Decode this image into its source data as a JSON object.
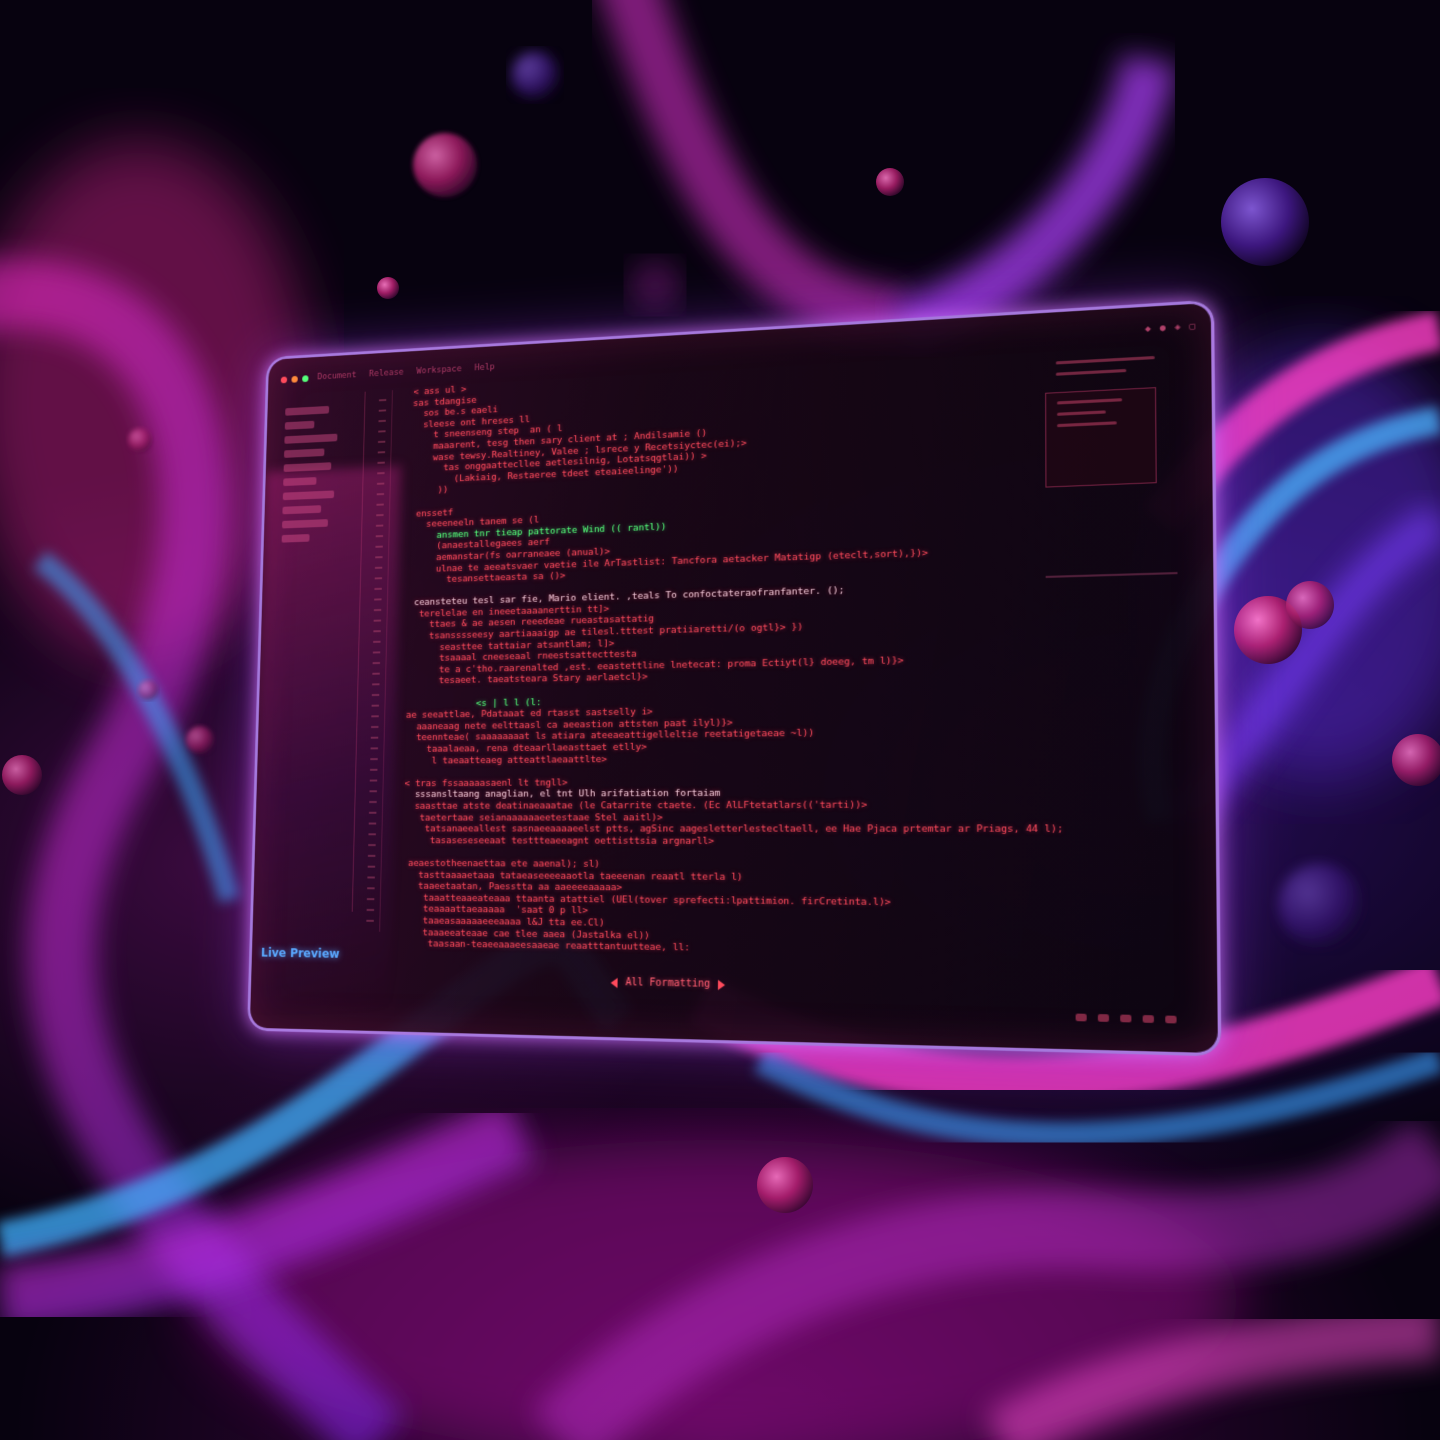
{
  "editor": {
    "menu": [
      "Document",
      "Release",
      "Workspace",
      "Help"
    ],
    "live_preview_label": "Live Preview",
    "status_label": "All Formatting"
  },
  "code_lines": [
    {
      "t": "  < ass ul >",
      "c": ""
    },
    {
      "t": "  sas tdangise",
      "c": ""
    },
    {
      "t": "    sos be.s eaeli",
      "c": ""
    },
    {
      "t": "    sleese ont hreses ll",
      "c": ""
    },
    {
      "t": "      t sneenseng step  an ( l",
      "c": ""
    },
    {
      "t": "      maaarent, tesg then sary client at ; Andilsamie ()",
      "c": ""
    },
    {
      "t": "      wase tewsy.Realtiney, Valee ; lsrece y Recetsiyctec(ei);>",
      "c": ""
    },
    {
      "t": "        tas onggaattecllee aetlesilnig, Lotatsqgtlai)) >",
      "c": ""
    },
    {
      "t": "          (Lakiaig, Restaeree tdeet eteaieelinge'))",
      "c": ""
    },
    {
      "t": "       ))",
      "c": ""
    },
    {
      "t": "",
      "c": ""
    },
    {
      "t": "   enssetf",
      "c": ""
    },
    {
      "t": "     seeeneeln tanem se (l",
      "c": ""
    },
    {
      "t": "       ansmen tnr tieap pattorate Wind (( rantl))",
      "c": "g"
    },
    {
      "t": "       (anaestallegaees aerf",
      "c": ""
    },
    {
      "t": "       aemanstar(fs oarraneaee (anual)>",
      "c": ""
    },
    {
      "t": "       ulnae te aeeatsvaer vaetie ile ArTastlist: Tancfora aetacker Matatigp (eteclt,sort),})>",
      "c": ""
    },
    {
      "t": "         tesansettaeasta sa ()>",
      "c": ""
    },
    {
      "t": "",
      "c": ""
    },
    {
      "t": "   ceansteteu tesl sar fie, Mario elient. ,teals To confoctateraofranfanter. ();",
      "c": "w"
    },
    {
      "t": "    terelelae en ineeetaaaanerttin tt]>",
      "c": ""
    },
    {
      "t": "      ttaes & ae aesen reeedeae rueastasattatig",
      "c": ""
    },
    {
      "t": "      tsansssseesy aartiaaaigp ae tilesl.tttest pratiiaretti/(o ogtl}> })",
      "c": ""
    },
    {
      "t": "        seasttee tattaiar atsantlam; l]>",
      "c": ""
    },
    {
      "t": "        tsaaaal cneeseaal rneestsattecttesta",
      "c": ""
    },
    {
      "t": "        te a c'tho.raarenalted ,est. eeastettline lnetecat: proma Ectiyt(l} doeeg, tm l)}>",
      "c": ""
    },
    {
      "t": "        tesaeet. taeatsteara Stary aerlaetcl}>",
      "c": ""
    },
    {
      "t": "",
      "c": ""
    },
    {
      "t": "               <s | l l (l:",
      "c": "g"
    },
    {
      "t": "  ae seeattlae, Pdataaat ed rtasst sastselly i>",
      "c": ""
    },
    {
      "t": "    aaaneaag nete eelttaasl ca aeeastion attsten paat ilyl)}>",
      "c": ""
    },
    {
      "t": "    teennteae( saaaaaaaat ls atiara ateeaeattigelleltie reetatigetaeae ~l))",
      "c": ""
    },
    {
      "t": "      taaalaeaa, rena dteaarllaeasttaet etlly>",
      "c": ""
    },
    {
      "t": "       l taeaatteaeg atteattlaeaattlte>",
      "c": ""
    },
    {
      "t": "",
      "c": ""
    },
    {
      "t": "  < tras fssaaaaasaenl lt tngll>",
      "c": ""
    },
    {
      "t": "    sssansltaang anaglian, el tnt Ulh arifatiation fortaiam",
      "c": "w"
    },
    {
      "t": "    saasttae atste deatinaeaaatae (le Catarrite ctaete. (Ec AlLFtetatlars(('tarti))>",
      "c": ""
    },
    {
      "t": "     taetertaae seianaaaaaaeetestaae Stel aaitl)>",
      "c": ""
    },
    {
      "t": "      tatsanaeeallest sasnaeeaaaaeelst ptts, agSinc aagesletterlestecltaell, ee Hae Pjaca prtemtar ar Priags, 44 l);",
      "c": ""
    },
    {
      "t": "       tasaseseseeaat testtteaeeagnt oettisttsia argnarll>",
      "c": ""
    },
    {
      "t": "",
      "c": ""
    },
    {
      "t": "   aeaestotheenaettaa ete aaenal); sl)",
      "c": ""
    },
    {
      "t": "     tasttaaaaetaaa tataeaseeeeaaotla taeeenan reaatl tterla l)",
      "c": ""
    },
    {
      "t": "     taaeetaatan, Paesstta aa aaeeeeaaaaa>",
      "c": ""
    },
    {
      "t": "      taaatteaaeateaaa ttaanta atattiel (UEl(tover sprefecti:lpattimion. firCretinta.l)>",
      "c": ""
    },
    {
      "t": "      teaaaattaeaaaaa  'saat 0 p ll>",
      "c": ""
    },
    {
      "t": "      taaeasaaaaaeeeaaaa l&J tta ee.Cl)",
      "c": ""
    },
    {
      "t": "      taaaeeateaae cae tlee aaea (Jastalka el))",
      "c": ""
    },
    {
      "t": "       taasaan-teaeeaaaeesaaeae reaatttantuutteae, ll:",
      "c": ""
    }
  ]
}
